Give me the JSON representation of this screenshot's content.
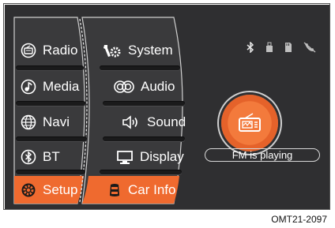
{
  "left_menu": [
    {
      "label": "Radio",
      "icon": "radio-icon"
    },
    {
      "label": "Media",
      "icon": "music-note-icon"
    },
    {
      "label": "Navi",
      "icon": "globe-icon"
    },
    {
      "label": "BT",
      "icon": "bluetooth-icon"
    },
    {
      "label": "Setup",
      "icon": "gear-icon",
      "active": true
    }
  ],
  "right_menu": [
    {
      "label": "System",
      "icon": "wrench-gear-icon"
    },
    {
      "label": "Audio",
      "icon": "speakers-icon"
    },
    {
      "label": "Sound",
      "icon": "speaker-volume-icon"
    },
    {
      "label": "Display",
      "icon": "monitor-icon"
    },
    {
      "label": "Car Info",
      "icon": "car-icon",
      "active": true
    }
  ],
  "status_icons": [
    "bluetooth-icon",
    "usb-icon",
    "sd-card-icon",
    "phone-muted-icon"
  ],
  "now_playing": {
    "icon": "radio-icon",
    "text": "FM is playing"
  },
  "caption": "OMT21-2097",
  "colors": {
    "accent": "#ef6a2f",
    "panel": "#2f2f31",
    "outline": "#d9d9d9"
  }
}
